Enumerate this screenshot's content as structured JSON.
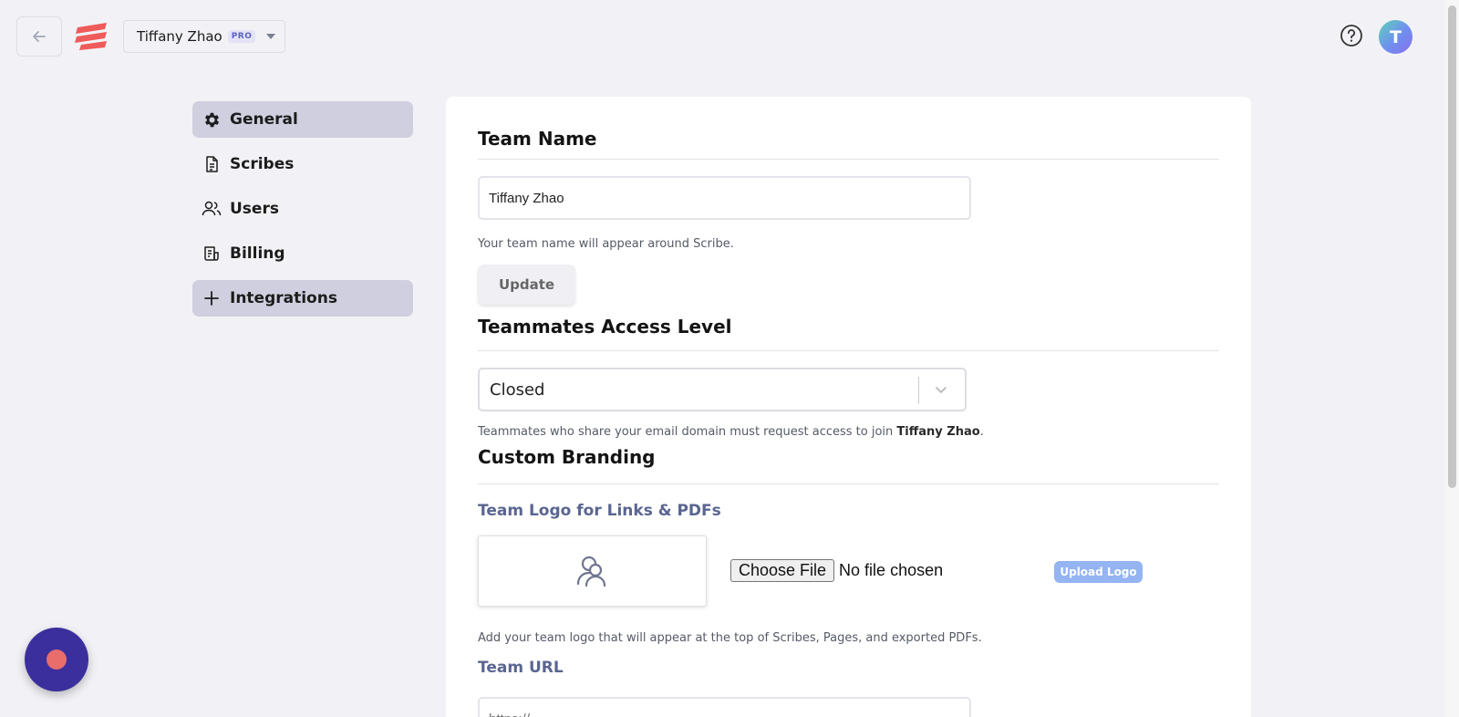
{
  "header": {
    "team_name": "Tiffany Zhao",
    "plan_badge": "PRO",
    "avatar_initial": "T"
  },
  "sidebar": {
    "items": [
      {
        "label": "General",
        "icon": "gear-icon",
        "active": true
      },
      {
        "label": "Scribes",
        "icon": "document-icon",
        "active": false
      },
      {
        "label": "Users",
        "icon": "users-icon",
        "active": false
      },
      {
        "label": "Billing",
        "icon": "billing-icon",
        "active": false
      },
      {
        "label": "Integrations",
        "icon": "plus-icon",
        "active": true
      }
    ]
  },
  "team_name_section": {
    "title": "Team Name",
    "input_value": "Tiffany Zhao",
    "help": "Your team name will appear around Scribe.",
    "update_label": "Update"
  },
  "access_section": {
    "title": "Teammates Access Level",
    "selected": "Closed",
    "help_prefix": "Teammates who share your email domain must request access to join ",
    "help_team": "Tiffany Zhao",
    "help_suffix": "."
  },
  "branding_section": {
    "title": "Custom Branding",
    "logo_subtitle": "Team Logo for Links & PDFs",
    "choose_file_label": "Choose File",
    "no_file_text": "No file chosen",
    "upload_label": "Upload Logo",
    "logo_help": "Add your team logo that will appear at the top of Scribes, Pages, and exported PDFs.",
    "url_subtitle": "Team URL",
    "url_placeholder": "https://"
  },
  "colors": {
    "background": "#f2f2f6",
    "active_nav": "#cfcfdf",
    "subheading": "#5a6590",
    "upload_button": "#94b4f2",
    "fab": "#3b2f9e",
    "fab_dot": "#e86d6b"
  }
}
